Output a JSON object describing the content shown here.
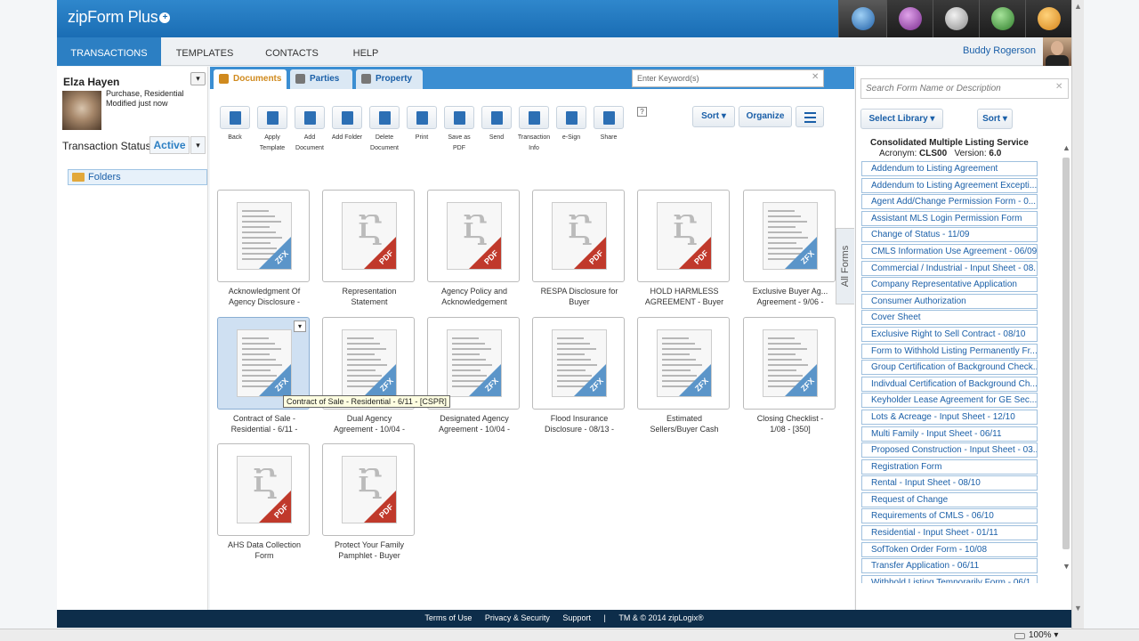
{
  "app": {
    "logo_text": "zipForm Plus"
  },
  "nav": {
    "tabs": [
      {
        "label": "TRANSACTIONS",
        "active": true
      },
      {
        "label": "TEMPLATES"
      },
      {
        "label": "CONTACTS"
      },
      {
        "label": "HELP"
      }
    ],
    "user_name": "Buddy Rogerson"
  },
  "app_icons": [
    "transactions-globe-icon",
    "purple-app-icon",
    "gear-app-icon",
    "green-app-icon",
    "orange-app-icon"
  ],
  "client": {
    "name": "Elza Hayen",
    "type": "Purchase, Residential",
    "modified": "Modified just now",
    "status_label": "Transaction Status",
    "status_value": "Active",
    "folders_label": "Folders"
  },
  "doc_tabs": [
    {
      "label": "Documents",
      "active": true
    },
    {
      "label": "Parties"
    },
    {
      "label": "Property"
    }
  ],
  "search": {
    "keyword_placeholder": "Enter Keyword(s)"
  },
  "toolbar": [
    {
      "label1": "Back",
      "label2": ""
    },
    {
      "label1": "Apply",
      "label2": "Template"
    },
    {
      "label1": "Add",
      "label2": "Document"
    },
    {
      "label1": "Add Folder",
      "label2": ""
    },
    {
      "label1": "Delete",
      "label2": "Document"
    },
    {
      "label1": "Print",
      "label2": ""
    },
    {
      "label1": "Save as",
      "label2": "PDF"
    },
    {
      "label1": "Send",
      "label2": ""
    },
    {
      "label1": "Transaction",
      "label2": "Info"
    },
    {
      "label1": "e-Sign",
      "label2": ""
    },
    {
      "label1": "Share",
      "label2": ""
    }
  ],
  "toolbar_right": {
    "help": "?",
    "sort": "Sort ▾",
    "organize": "Organize"
  },
  "documents": [
    {
      "line1": "Acknowledgment Of",
      "line2": "Agency Disclosure -",
      "kind": "ZFX"
    },
    {
      "line1": "Representation",
      "line2": "Statement",
      "kind": "PDF"
    },
    {
      "line1": "Agency Policy and",
      "line2": "Acknowledgement",
      "kind": "PDF"
    },
    {
      "line1": "RESPA Disclosure for",
      "line2": "Buyer",
      "kind": "PDF"
    },
    {
      "line1": "HOLD HARMLESS",
      "line2": "AGREEMENT - Buyer",
      "kind": "PDF"
    },
    {
      "line1": "Exclusive Buyer Ag...",
      "line2": "Agreement - 9/06 -",
      "kind": "ZFX"
    },
    {
      "line1": "Contract of Sale -",
      "line2": "Residential - 6/11 -",
      "kind": "ZFX",
      "selected": true
    },
    {
      "line1": "Dual Agency",
      "line2": "Agreement - 10/04 -",
      "kind": "ZFX"
    },
    {
      "line1": "Designated Agency",
      "line2": "Agreement - 10/04 -",
      "kind": "ZFX"
    },
    {
      "line1": "Flood Insurance",
      "line2": "Disclosure - 08/13 -",
      "kind": "ZFX"
    },
    {
      "line1": "Estimated",
      "line2": "Sellers/Buyer Cash",
      "kind": "ZFX"
    },
    {
      "line1": "Closing Checklist -",
      "line2": "1/08 - [350]",
      "kind": "ZFX"
    },
    {
      "line1": "AHS Data Collection",
      "line2": "Form",
      "kind": "PDF"
    },
    {
      "line1": "Protect Your Family",
      "line2": "Pamphlet - Buyer",
      "kind": "PDF"
    }
  ],
  "tooltip": "Contract of Sale - Residential - 6/11 - [CSPR]",
  "all_forms_label": "All Forms",
  "forms_panel": {
    "search_placeholder": "Search Form Name or Description",
    "select_library": "Select Library ▾",
    "sort": "Sort ▾",
    "library_name": "Consolidated Multiple Listing Service",
    "acronym_label": "Acronym:",
    "acronym": "CLS00",
    "version_label": "Version:",
    "version": "6.0",
    "forms": [
      "Addendum to Listing Agreement",
      "Addendum to Listing Agreement Excepti...",
      "Agent Add/Change Permission Form - 0...",
      "Assistant MLS Login Permission Form",
      "Change of Status - 11/09",
      "CMLS Information Use Agreement - 06/09",
      "Commercial / Industrial - Input Sheet - 08...",
      "Company Representative Application",
      "Consumer Authorization",
      "Cover Sheet",
      "Exclusive Right to Sell Contract - 08/10",
      "Form to Withhold Listing Permanently Fr...",
      "Group Certification of Background Check...",
      "Indivdual Certification of Background Ch...",
      "Keyholder Lease Agreement for GE Sec...",
      "Lots & Acreage - Input Sheet - 12/10",
      "Multi Family - Input Sheet - 06/11",
      "Proposed Construction - Input Sheet - 03...",
      "Registration Form",
      "Rental - Input Sheet - 08/10",
      "Request of Change",
      "Requirements of CMLS - 06/10",
      "Residential - Input Sheet - 01/11",
      "SofToken Order Form - 10/08",
      "Transfer Application - 06/11",
      "Withhold Listing Temporarily Form - 06/1..."
    ]
  },
  "footer": {
    "terms": "Terms of Use",
    "privacy": "Privacy & Security",
    "support": "Support",
    "sep": "|",
    "copyright": "TM & © 2014 zipLogix®"
  },
  "status_bar": {
    "zoom": "100% ▾"
  },
  "colors": {
    "brand_blue": "#2c7fc3",
    "footer": "#0d2d4a",
    "pdf_red": "#c0392b",
    "zfx_blue": "#5b95c9"
  }
}
